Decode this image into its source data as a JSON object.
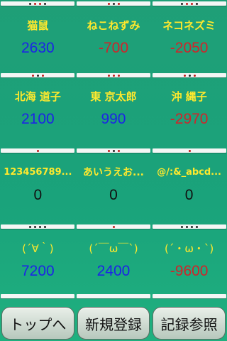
{
  "rows": [
    {
      "players": [
        {
          "name": "猫鼠",
          "score": "2630",
          "score_color": "blue"
        },
        {
          "name": "ねこねずみ",
          "score": "-700",
          "score_color": "red"
        },
        {
          "name": "ネコネズミ",
          "score": "-2050",
          "score_color": "red"
        }
      ]
    },
    {
      "players": [
        {
          "name": "北海 道子",
          "score": "2100",
          "score_color": "blue"
        },
        {
          "name": "東 京太郎",
          "score": "990",
          "score_color": "blue"
        },
        {
          "name": "沖 縄子",
          "score": "-2970",
          "score_color": "red"
        }
      ]
    },
    {
      "players": [
        {
          "name": "123456789...",
          "score": "0",
          "score_color": "black"
        },
        {
          "name": "あいうえお...",
          "score": "0",
          "score_color": "black"
        },
        {
          "name": "@/:&_abcd...",
          "score": "0",
          "score_color": "black"
        }
      ]
    },
    {
      "players": [
        {
          "name": "(´∀｀)",
          "score": "7200",
          "score_color": "blue"
        },
        {
          "name": "(´￣ω￣`)",
          "score": "2400",
          "score_color": "blue"
        },
        {
          "name": "(´・ω・`)",
          "score": "-9600",
          "score_color": "red"
        }
      ]
    }
  ],
  "buttons": {
    "top": "トップへ",
    "new": "新規登録",
    "records": "記録参照"
  },
  "colors": {
    "background": "#1aa37b",
    "name": "#ffe92d",
    "positive": "#1c24e6",
    "negative": "#d0242a"
  }
}
